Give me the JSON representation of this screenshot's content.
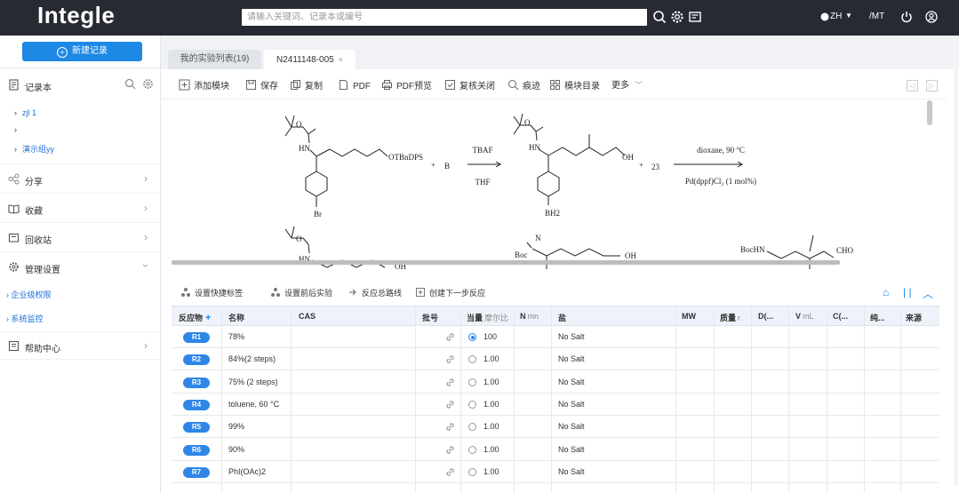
{
  "app": {
    "logo": "Integle",
    "search_placeholder": "请输入关键词、记录本或编号",
    "user_name": "ZH",
    "user_code": "/MT"
  },
  "sidebar": {
    "new_button": "新建记录",
    "notebook_label": "记录本",
    "tree": [
      {
        "label": "zjl 1"
      },
      {
        "label": ""
      },
      {
        "label": "演示组yy"
      }
    ],
    "items": [
      {
        "label": "分享",
        "icon": "share-icon"
      },
      {
        "label": "收藏",
        "icon": "book-icon"
      },
      {
        "label": "回收站",
        "icon": "trash-icon"
      },
      {
        "label": "管理设置",
        "icon": "gear-icon"
      }
    ],
    "sub_links": [
      {
        "label": "企业级权限"
      },
      {
        "label": "系统监控"
      }
    ],
    "help": {
      "label": "帮助中心",
      "icon": "help-icon"
    }
  },
  "tabs": [
    {
      "label": "我的实验列表(19)",
      "active": false
    },
    {
      "label": "N2411148-005",
      "active": true,
      "close": "×"
    }
  ],
  "toolbar": [
    {
      "label": "添加模块",
      "icon": "add-module-icon"
    },
    {
      "label": "保存",
      "icon": "save-icon"
    },
    {
      "label": "复制",
      "icon": "copy-icon"
    },
    {
      "label": "PDF",
      "icon": "pdf-icon"
    },
    {
      "label": "PDF预览",
      "icon": "print-icon"
    },
    {
      "label": "复核关闭",
      "icon": "review-icon"
    },
    {
      "label": "痕迹",
      "icon": "trace-icon"
    },
    {
      "label": "模块目录",
      "icon": "catalog-icon"
    },
    {
      "label": "更多",
      "icon": "chevron-down-icon"
    }
  ],
  "scheme": {
    "reactant1": {
      "protect": "O",
      "nh": "HN",
      "otbs": "OTBnDPS",
      "br": "Br"
    },
    "plus": "+",
    "reagent_b": "B",
    "arrow1": {
      "top": "TBAF",
      "bottom": "THF"
    },
    "product1": {
      "protect": "O",
      "nh": "HN",
      "oh": "OH",
      "b": "BH2"
    },
    "plus2": "+",
    "n23": "23",
    "arrow2": {
      "top": "dioxane, 90 °C",
      "bottom": "Pd(dppf)Cl₂ (1 mol%)"
    },
    "row2": {
      "protect": "O",
      "nh": "HN",
      "oh": "OH",
      "boc": "Boc",
      "nh2": "N",
      "oh2": "OH",
      "bochn": "BocHN",
      "cho": "CHO"
    }
  },
  "reaction_toolbar": [
    {
      "label": "设置快捷标签",
      "icon": "molecule-icon"
    },
    {
      "label": "设置前后实验",
      "icon": "molecule-icon"
    },
    {
      "label": "反应总路线",
      "icon": "route-icon"
    },
    {
      "label": "创建下一步反应",
      "icon": "create-icon"
    }
  ],
  "table": {
    "headers": [
      {
        "label": "反应物",
        "add": "+"
      },
      {
        "label": "名称"
      },
      {
        "label": "CAS"
      },
      {
        "label": "批号"
      },
      {
        "label": "当量",
        "unit": "摩尔比"
      },
      {
        "label": "N",
        "unit": "mn"
      },
      {
        "label": "盐"
      },
      {
        "label": "MW"
      },
      {
        "label": "质量",
        "unit": "r"
      },
      {
        "label": "D(..."
      },
      {
        "label": "V",
        "unit": "mL"
      },
      {
        "label": "C(..."
      },
      {
        "label": "纯..."
      },
      {
        "label": "来源"
      }
    ],
    "rows": [
      {
        "id": "R1",
        "name": "78%",
        "eq": "100",
        "salt": "No Salt",
        "selected": true
      },
      {
        "id": "R2",
        "name": "84%(2 steps)",
        "eq": "1.00",
        "salt": "No Salt",
        "selected": false
      },
      {
        "id": "R3",
        "name": "75% (2 steps)",
        "eq": "1.00",
        "salt": "No Salt",
        "selected": false
      },
      {
        "id": "R4",
        "name": "toluene, 60 °C",
        "eq": "1.00",
        "salt": "No Salt",
        "selected": false
      },
      {
        "id": "R5",
        "name": "99%",
        "eq": "1.00",
        "salt": "No Salt",
        "selected": false
      },
      {
        "id": "R6",
        "name": "90%",
        "eq": "1.00",
        "salt": "No Salt",
        "selected": false
      },
      {
        "id": "R7",
        "name": "PhI(OAc)2",
        "eq": "1.00",
        "salt": "No Salt",
        "selected": false
      }
    ]
  }
}
